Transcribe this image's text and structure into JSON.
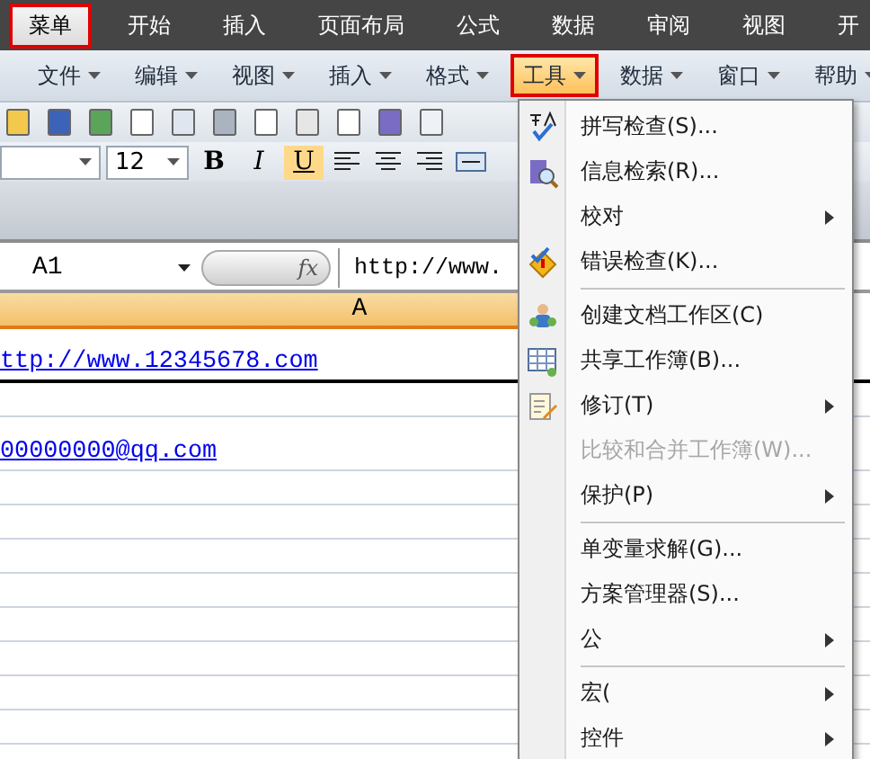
{
  "ribbon_tabs": [
    {
      "label": "菜单",
      "selected": true
    },
    {
      "label": "开始",
      "selected": false
    },
    {
      "label": "插入",
      "selected": false
    },
    {
      "label": "页面布局",
      "selected": false
    },
    {
      "label": "公式",
      "selected": false
    },
    {
      "label": "数据",
      "selected": false
    },
    {
      "label": "审阅",
      "selected": false
    },
    {
      "label": "视图",
      "selected": false
    },
    {
      "label": "开",
      "selected": false
    }
  ],
  "menu_bar": [
    {
      "label": "文件",
      "selected": false
    },
    {
      "label": "编辑",
      "selected": false
    },
    {
      "label": "视图",
      "selected": false
    },
    {
      "label": "插入",
      "selected": false
    },
    {
      "label": "格式",
      "selected": false
    },
    {
      "label": "工具",
      "selected": true
    },
    {
      "label": "数据",
      "selected": false
    },
    {
      "label": "窗口",
      "selected": false
    },
    {
      "label": "帮助",
      "selected": false
    }
  ],
  "font_size": "12",
  "format_buttons": [
    {
      "label": "B",
      "selected": false
    },
    {
      "label": "I",
      "selected": false
    },
    {
      "label": "U",
      "selected": true
    }
  ],
  "name_box": "A1",
  "function_label": "fx",
  "formula": "http://www.",
  "column_header": "A",
  "rows": [
    {
      "link": "ttp://www.12345678.com"
    },
    {},
    {
      "link": "00000000@qq.com"
    },
    {},
    {},
    {},
    {},
    {},
    {},
    {},
    {},
    {}
  ],
  "tools_menu": [
    {
      "kind": "item",
      "label": "拼写检查(S)...",
      "icon": true,
      "submenu": false,
      "disabled": false
    },
    {
      "kind": "item",
      "label": "信息检索(R)...",
      "icon": true,
      "submenu": false,
      "disabled": false
    },
    {
      "kind": "item",
      "label": "校对",
      "icon": false,
      "submenu": true,
      "disabled": false
    },
    {
      "kind": "item",
      "label": "错误检查(K)...",
      "icon": true,
      "submenu": false,
      "disabled": false
    },
    {
      "kind": "separator"
    },
    {
      "kind": "item",
      "label": "创建文档工作区(C)",
      "icon": true,
      "submenu": false,
      "disabled": false
    },
    {
      "kind": "item",
      "label": "共享工作簿(B)...",
      "icon": true,
      "submenu": false,
      "disabled": false
    },
    {
      "kind": "item",
      "label": "修订(T)",
      "icon": true,
      "submenu": true,
      "disabled": false
    },
    {
      "kind": "item",
      "label": "比较和合并工作簿(W)...",
      "icon": false,
      "submenu": false,
      "disabled": true
    },
    {
      "kind": "item",
      "label": "保护(P)",
      "icon": false,
      "submenu": true,
      "disabled": false
    },
    {
      "kind": "separator"
    },
    {
      "kind": "item",
      "label": "单变量求解(G)...",
      "icon": false,
      "submenu": false,
      "disabled": false
    },
    {
      "kind": "item",
      "label": "方案管理器(S)...",
      "icon": false,
      "submenu": false,
      "disabled": false
    },
    {
      "kind": "item",
      "label": "公",
      "icon": false,
      "submenu": true,
      "disabled": false
    },
    {
      "kind": "separator"
    },
    {
      "kind": "item",
      "label": "宏(",
      "icon": false,
      "submenu": true,
      "disabled": false
    },
    {
      "kind": "item",
      "label": "控件",
      "icon": false,
      "submenu": true,
      "disabled": false
    }
  ]
}
